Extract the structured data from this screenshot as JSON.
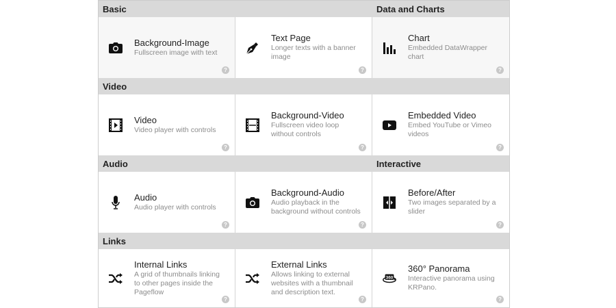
{
  "sections": {
    "basic": "Basic",
    "data_and_charts": "Data and Charts",
    "video": "Video",
    "audio": "Audio",
    "interactive": "Interactive",
    "links": "Links"
  },
  "help_glyph": "?",
  "tiles": {
    "background_image": {
      "title": "Background-Image",
      "desc": "Fullscreen image with text",
      "icon": "camera-icon"
    },
    "text_page": {
      "title": "Text Page",
      "desc": "Longer texts with a banner image",
      "icon": "pen-nib-icon"
    },
    "chart": {
      "title": "Chart",
      "desc": "Embedded DataWrapper chart",
      "icon": "bar-chart-icon"
    },
    "video": {
      "title": "Video",
      "desc": "Video player with controls",
      "icon": "film-play-icon"
    },
    "background_video": {
      "title": "Background-Video",
      "desc": "Fullscreen video loop without controls",
      "icon": "film-icon"
    },
    "embedded_video": {
      "title": "Embedded Video",
      "desc": "Embed YouTube or Vimeo videos",
      "icon": "youtube-icon"
    },
    "audio": {
      "title": "Audio",
      "desc": "Audio player with controls",
      "icon": "microphone-icon"
    },
    "background_audio": {
      "title": "Background-Audio",
      "desc": "Audio playback in the background without controls",
      "icon": "camera-icon"
    },
    "before_after": {
      "title": "Before/After",
      "desc": "Two images separated by a slider",
      "icon": "before-after-icon"
    },
    "internal_links": {
      "title": "Internal Links",
      "desc": "A grid of thumbnails linking to other pages inside the Pageflow",
      "icon": "shuffle-icon"
    },
    "external_links": {
      "title": "External Links",
      "desc": "Allows linking to external websites with a thumbnail and description text.",
      "icon": "shuffle-icon"
    },
    "panorama": {
      "title": "360° Panorama",
      "desc": "Interactive panorama using KRPano.",
      "icon": "panorama-360-icon"
    }
  }
}
